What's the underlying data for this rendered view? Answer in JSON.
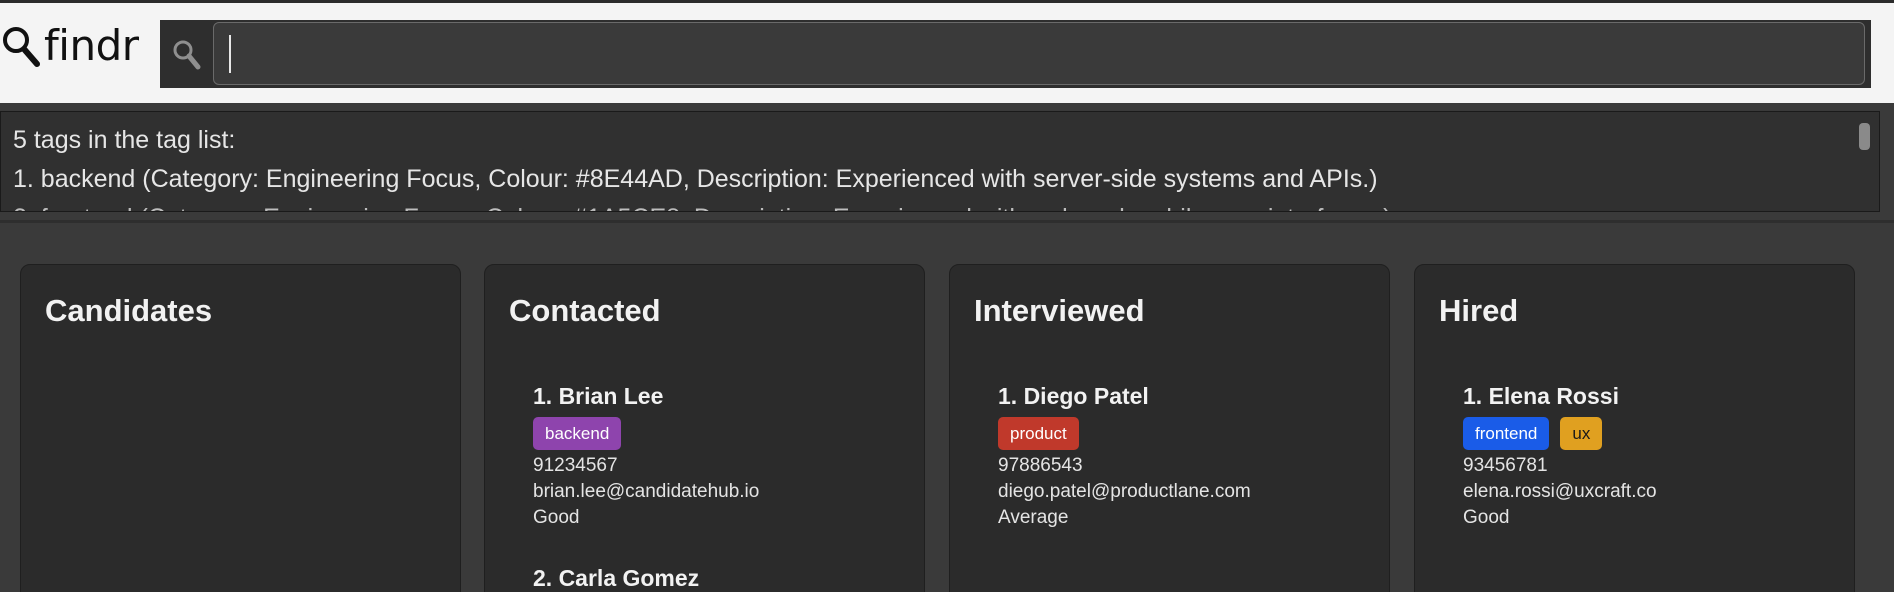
{
  "app": {
    "name": "findr"
  },
  "command_box": {
    "value": "",
    "placeholder": ""
  },
  "result_display": {
    "lines": [
      "5 tags in the tag list:",
      "1. backend (Category: Engineering Focus, Colour: #8E44AD, Description: Experienced with server-side systems and APIs.)"
    ]
  },
  "columns": [
    {
      "title": "Candidates",
      "cards": []
    },
    {
      "title": "Contacted",
      "cards": [
        {
          "name": "1. Brian Lee",
          "tags": [
            {
              "label": "backend",
              "color": "#8E44AD",
              "text_color": "#ffffff"
            }
          ],
          "phone": "91234567",
          "email": "brian.lee@candidatehub.io",
          "rating": "Good"
        },
        {
          "name": "2. Carla Gomez",
          "tags": [],
          "phone": "",
          "email": "",
          "rating": ""
        }
      ]
    },
    {
      "title": "Interviewed",
      "cards": [
        {
          "name": "1. Diego Patel",
          "tags": [
            {
              "label": "product",
              "color": "#C0392B",
              "text_color": "#ffffff"
            }
          ],
          "phone": "97886543",
          "email": "diego.patel@productlane.com",
          "rating": "Average"
        }
      ]
    },
    {
      "title": "Hired",
      "cards": [
        {
          "name": "1. Elena Rossi",
          "tags": [
            {
              "label": "frontend",
              "color": "#1A5CE8",
              "text_color": "#ffffff"
            },
            {
              "label": "ux",
              "color": "#E0A020",
              "text_color": "#1a1a1a"
            }
          ],
          "phone": "93456781",
          "email": "elena.rossi@uxcraft.co",
          "rating": "Good"
        }
      ]
    }
  ],
  "colors": {
    "topbar_bg": "#f4f4f4",
    "panel_bg": "#2b2b2b",
    "app_bg": "#3a3a3a"
  }
}
